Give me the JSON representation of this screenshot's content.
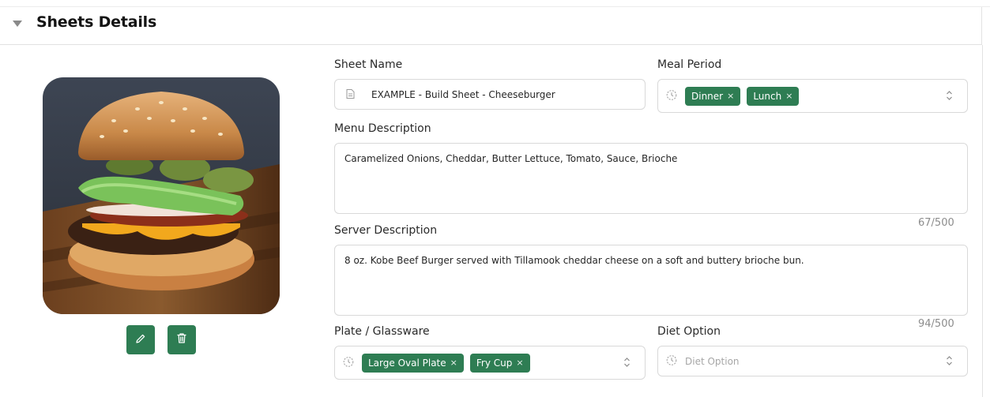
{
  "section": {
    "title": "Sheets Details"
  },
  "image": {
    "alt": "Cheeseburger photo"
  },
  "actions": {
    "edit_icon": "pencil-icon",
    "delete_icon": "trash-icon"
  },
  "sheet_name": {
    "label": "Sheet Name",
    "value": "EXAMPLE - Build Sheet - Cheeseburger",
    "icon": "document-icon"
  },
  "meal_period": {
    "label": "Meal Period",
    "chips": [
      "Dinner",
      "Lunch"
    ],
    "chip_remove": "×"
  },
  "menu_description": {
    "label": "Menu Description",
    "value": "Caramelized Onions, Cheddar, Butter Lettuce, Tomato, Sauce, Brioche",
    "counter": "67/500"
  },
  "server_description": {
    "label": "Server Description",
    "value": "8 oz. Kobe Beef Burger served with Tillamook cheddar cheese on a soft and buttery brioche bun.",
    "counter": "94/500"
  },
  "plate_glassware": {
    "label": "Plate / Glassware",
    "chips": [
      "Large Oval Plate",
      "Fry Cup"
    ],
    "chip_remove": "×"
  },
  "diet_option": {
    "label": "Diet Option",
    "placeholder": "Diet Option"
  },
  "colors": {
    "accent": "#2e7d53",
    "border": "#d9d9d9",
    "muted_text": "#8c8c8c"
  }
}
